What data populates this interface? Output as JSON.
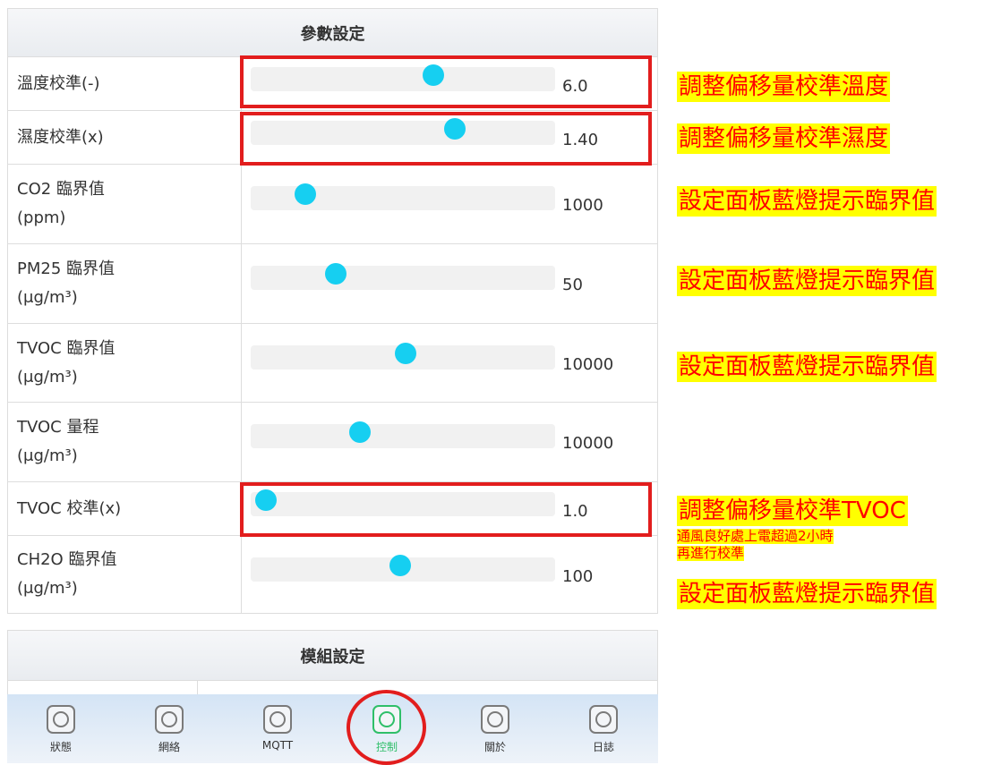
{
  "params": {
    "title": "參數設定",
    "rows": [
      {
        "label_lines": [
          "溫度校準(-)",
          ""
        ],
        "value": "6.0",
        "level": 0.6
      },
      {
        "label_lines": [
          "濕度校準(x)",
          ""
        ],
        "value": "1.40",
        "level": 0.67
      },
      {
        "label_lines": [
          "CO2 臨界值",
          "(ppm)"
        ],
        "value": "1000",
        "level": 0.18
      },
      {
        "label_lines": [
          "PM25 臨界值",
          "(μg/m³)"
        ],
        "value": "50",
        "level": 0.28
      },
      {
        "label_lines": [
          "TVOC 臨界值",
          "(μg/m³)"
        ],
        "value": "10000",
        "level": 0.51
      },
      {
        "label_lines": [
          "TVOC 量程",
          "(μg/m³)"
        ],
        "value": "10000",
        "level": 0.36
      },
      {
        "label_lines": [
          "TVOC 校準(x)",
          ""
        ],
        "value": "1.0",
        "level": 0.05
      },
      {
        "label_lines": [
          "CH2O 臨界值",
          "(μg/m³)"
        ],
        "value": "100",
        "level": 0.49
      }
    ]
  },
  "module": {
    "title": "模組設定"
  },
  "annotations": {
    "temp": "調整偏移量校準溫度",
    "humidity": "調整偏移量校準濕度",
    "co2": "設定面板藍燈提示臨界值",
    "pm25": "設定面板藍燈提示臨界值",
    "tvoc": "設定面板藍燈提示臨界值",
    "tvoc_cal": "調整偏移量校準TVOC",
    "tvoc_cal_note1": "通風良好處上電超過2小時",
    "tvoc_cal_note2": "再進行校準",
    "ch2o": "設定面板藍燈提示臨界值"
  },
  "nav": {
    "items": [
      "狀態",
      "網絡",
      "MQTT",
      "控制",
      "關於",
      "日誌"
    ],
    "active": "控制"
  },
  "colors": {
    "accent": "#16cff1",
    "highlight_box": "#e21d1d",
    "note_bg": "#ffff00",
    "note_text": "#ff0000",
    "nav_active": "#2fbf69"
  }
}
